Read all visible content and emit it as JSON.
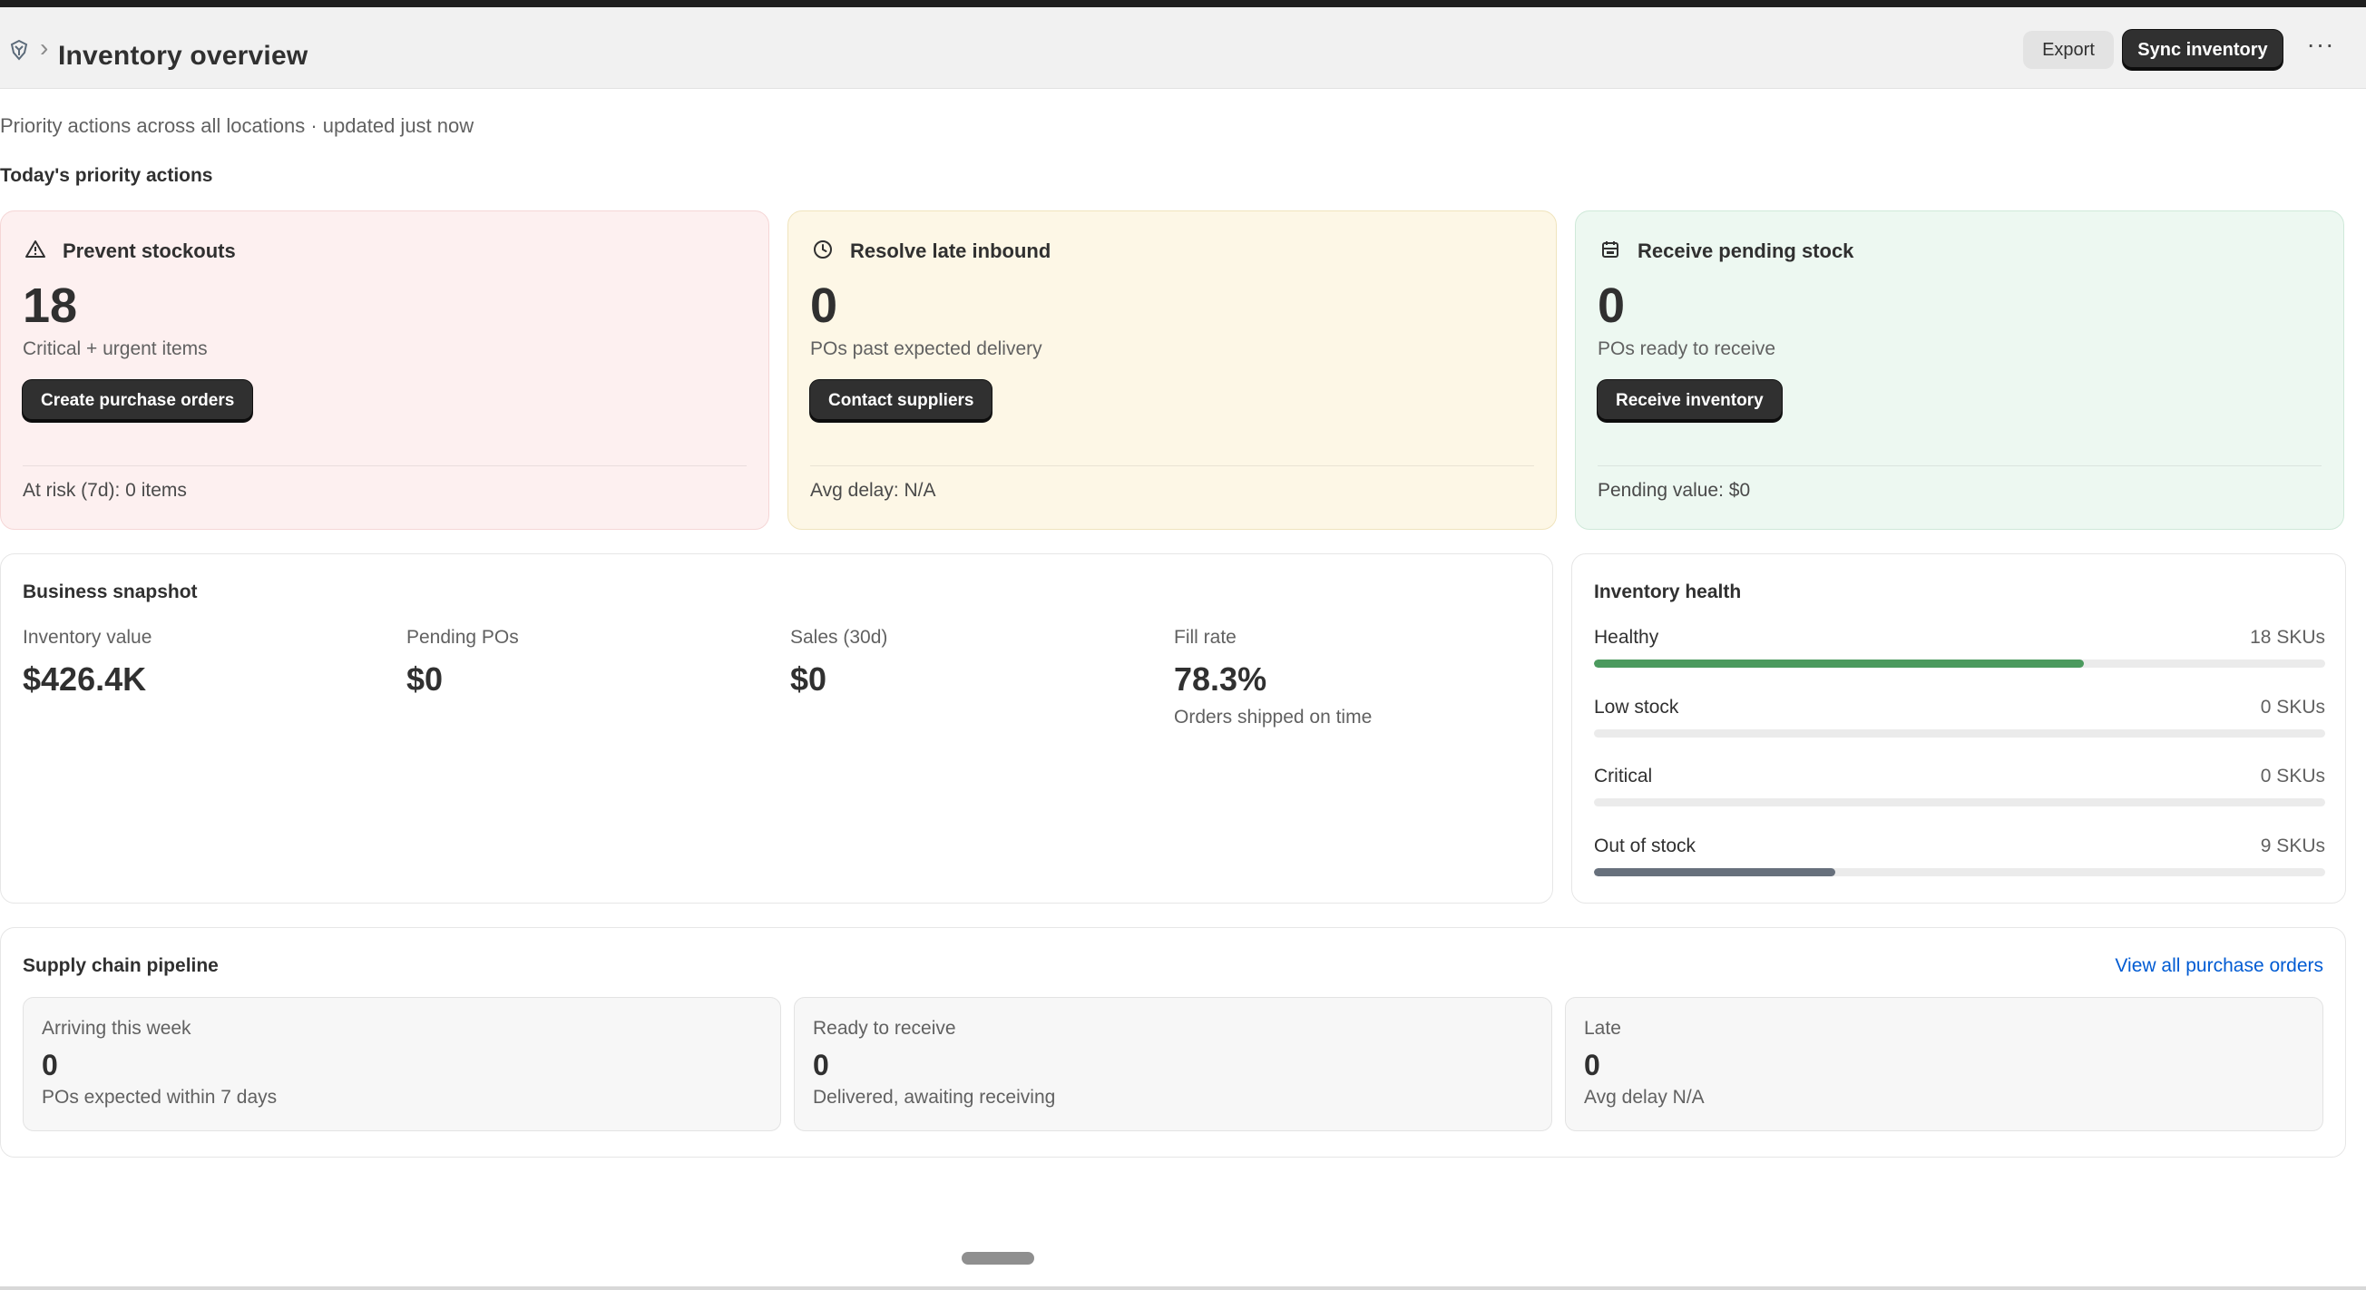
{
  "header": {
    "title": "Inventory overview",
    "breadcrumb_separator": "›",
    "export_label": "Export",
    "sync_label": "Sync inventory",
    "more_label": "···"
  },
  "subtitle": "Priority actions across all locations · updated just now",
  "priority": {
    "heading": "Today's priority actions",
    "cards": [
      {
        "icon": "alert-triangle-icon",
        "title": "Prevent stockouts",
        "value": "18",
        "desc": "Critical + urgent items",
        "button": "Create purchase orders",
        "footer": "At risk (7d): 0 items",
        "color": "#fdf0f0"
      },
      {
        "icon": "clock-icon",
        "title": "Resolve late inbound",
        "value": "0",
        "desc": "POs past expected delivery",
        "button": "Contact suppliers",
        "footer": "Avg delay: N/A",
        "color": "#fdf7e6"
      },
      {
        "icon": "inbox-icon",
        "title": "Receive pending stock",
        "value": "0",
        "desc": "POs ready to receive",
        "button": "Receive inventory",
        "footer": "Pending value: $0",
        "color": "#edf8f1"
      }
    ]
  },
  "snapshot": {
    "title": "Business snapshot",
    "metrics": [
      {
        "label": "Inventory value",
        "value": "$426.4K",
        "sub": ""
      },
      {
        "label": "Pending POs",
        "value": "$0",
        "sub": ""
      },
      {
        "label": "Sales (30d)",
        "value": "$0",
        "sub": ""
      },
      {
        "label": "Fill rate",
        "value": "78.3%",
        "sub": "Orders shipped on time"
      }
    ]
  },
  "health": {
    "title": "Inventory health",
    "rows": [
      {
        "label": "Healthy",
        "count": "18 SKUs",
        "fraction": 0.67,
        "color": "#4b9a5e"
      },
      {
        "label": "Low stock",
        "count": "0 SKUs",
        "fraction": 0,
        "color": "#e0b33b"
      },
      {
        "label": "Critical",
        "count": "0 SKUs",
        "fraction": 0,
        "color": "#d9534f"
      },
      {
        "label": "Out of stock",
        "count": "9 SKUs",
        "fraction": 0.33,
        "color": "#67707c"
      }
    ]
  },
  "pipeline": {
    "title": "Supply chain pipeline",
    "link": "View all purchase orders",
    "boxes": [
      {
        "label": "Arriving this week",
        "value": "0",
        "sub": "POs expected within 7 days"
      },
      {
        "label": "Ready to receive",
        "value": "0",
        "sub": "Delivered, awaiting receiving"
      },
      {
        "label": "Late",
        "value": "0",
        "sub": "Avg delay N/A"
      }
    ]
  }
}
